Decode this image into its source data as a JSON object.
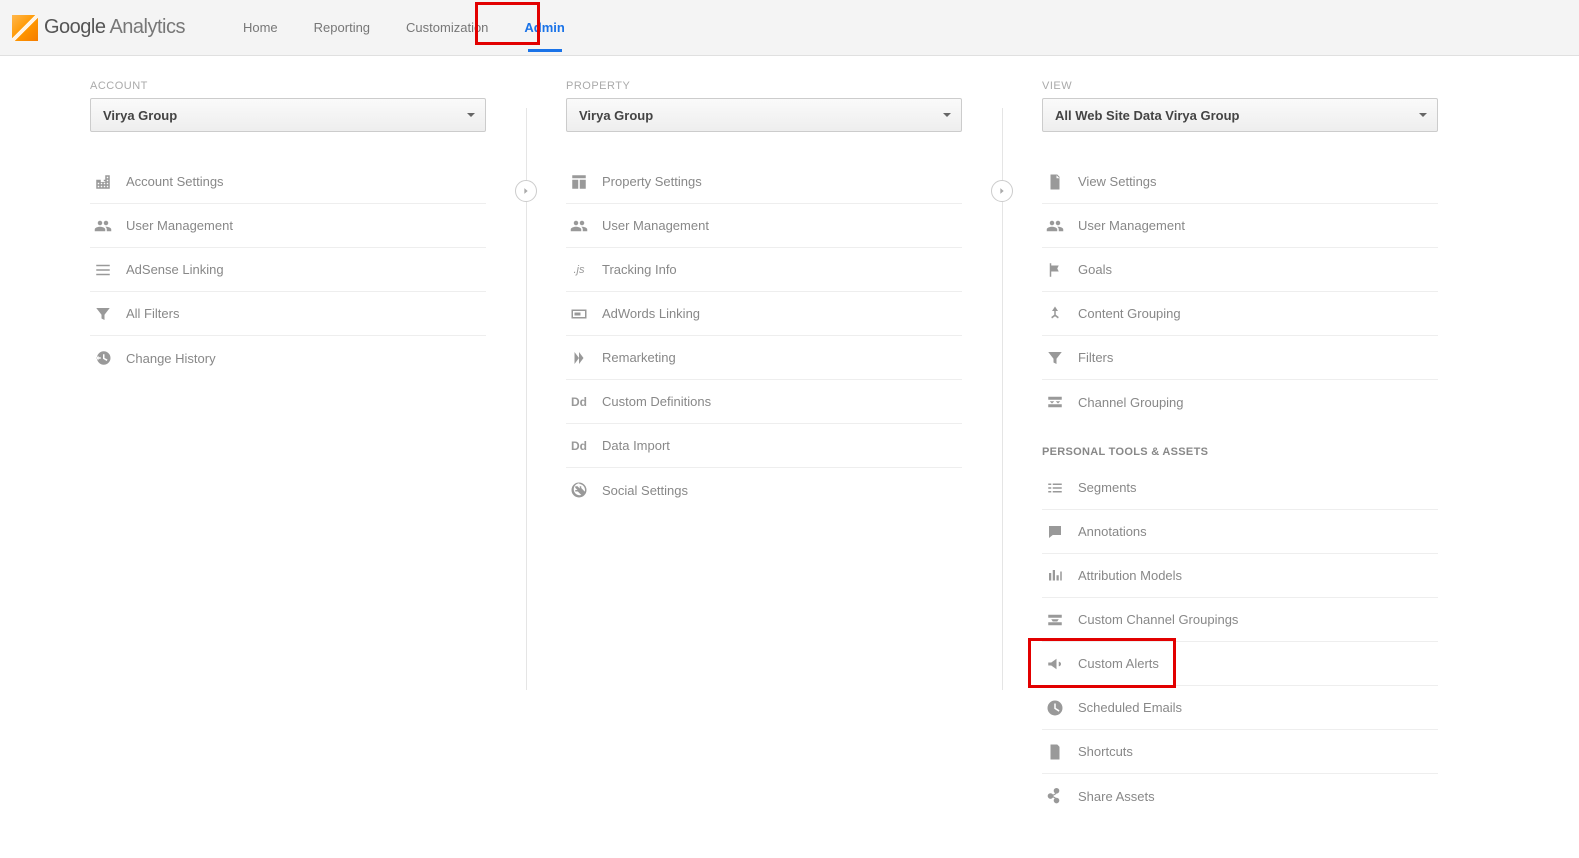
{
  "brand": {
    "google": "Google",
    "analytics": "Analytics"
  },
  "nav": {
    "home": "Home",
    "reporting": "Reporting",
    "customization": "Customization",
    "admin": "Admin"
  },
  "account": {
    "label": "ACCOUNT",
    "selected": "Virya Group",
    "items": {
      "account_settings": "Account Settings",
      "user_management": "User Management",
      "adsense_linking": "AdSense Linking",
      "all_filters": "All Filters",
      "change_history": "Change History"
    }
  },
  "property": {
    "label": "PROPERTY",
    "selected": "Virya Group",
    "items": {
      "property_settings": "Property Settings",
      "user_management": "User Management",
      "tracking_info": "Tracking Info",
      "adwords_linking": "AdWords Linking",
      "remarketing": "Remarketing",
      "custom_definitions": "Custom Definitions",
      "data_import": "Data Import",
      "social_settings": "Social Settings"
    }
  },
  "view": {
    "label": "VIEW",
    "selected": "All Web Site Data Virya Group",
    "items": {
      "view_settings": "View Settings",
      "user_management": "User Management",
      "goals": "Goals",
      "content_grouping": "Content Grouping",
      "filters": "Filters",
      "channel_grouping": "Channel Grouping"
    },
    "personal_label": "PERSONAL TOOLS & ASSETS",
    "personal": {
      "segments": "Segments",
      "annotations": "Annotations",
      "attribution_models": "Attribution Models",
      "custom_channel_groupings": "Custom Channel Groupings",
      "custom_alerts": "Custom Alerts",
      "scheduled_emails": "Scheduled Emails",
      "shortcuts": "Shortcuts",
      "share_assets": "Share Assets"
    }
  }
}
